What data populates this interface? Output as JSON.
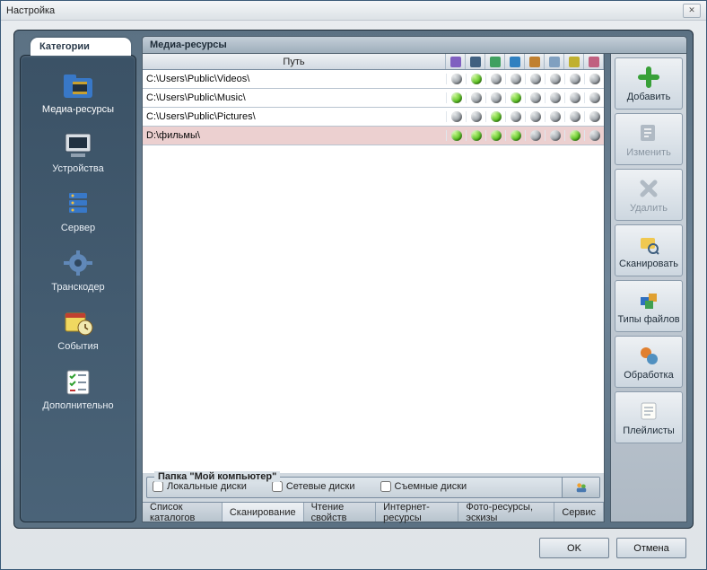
{
  "window": {
    "title": "Настройка"
  },
  "sidebar": {
    "tab": "Категории",
    "items": [
      {
        "label": "Медиа-ресурсы",
        "icon": "folder-media-icon",
        "selected": true
      },
      {
        "label": "Устройства",
        "icon": "devices-icon"
      },
      {
        "label": "Сервер",
        "icon": "server-icon"
      },
      {
        "label": "Транскодер",
        "icon": "gear-icon"
      },
      {
        "label": "События",
        "icon": "calendar-clock-icon"
      },
      {
        "label": "Дополнительно",
        "icon": "checklist-icon"
      }
    ]
  },
  "content": {
    "header": "Медиа-ресурсы",
    "table": {
      "path_header": "Путь",
      "col_icons": [
        "music-icon",
        "video-icon",
        "image-icon",
        "globe-icon",
        "speaker-icon",
        "cloud-icon",
        "cube-icon",
        "misc-icon"
      ],
      "rows": [
        {
          "path": "C:\\Users\\Public\\Videos\\",
          "cells": [
            "off",
            "on",
            "off",
            "off",
            "off",
            "off",
            "off",
            "off"
          ]
        },
        {
          "path": "C:\\Users\\Public\\Music\\",
          "cells": [
            "on",
            "off",
            "off",
            "on",
            "off",
            "off",
            "off",
            "off"
          ]
        },
        {
          "path": "C:\\Users\\Public\\Pictures\\",
          "cells": [
            "off",
            "off",
            "on",
            "off",
            "off",
            "off",
            "off",
            "off"
          ]
        },
        {
          "path": "D:\\фильмы\\",
          "cells": [
            "on",
            "on",
            "on",
            "on",
            "off",
            "off",
            "on",
            "off"
          ],
          "selected": true
        }
      ]
    },
    "groupbox": {
      "title": "Папка \"Мой компьютер\"",
      "checks": [
        {
          "label": "Локальные диски",
          "checked": false
        },
        {
          "label": "Сетевые диски",
          "checked": false
        },
        {
          "label": "Съемные диски",
          "checked": false
        }
      ]
    },
    "tabs": [
      {
        "label": "Список каталогов",
        "active": false
      },
      {
        "label": "Сканирование",
        "active": true
      },
      {
        "label": "Чтение свойств",
        "active": false
      },
      {
        "label": "Интернет-ресурсы",
        "active": false
      },
      {
        "label": "Фото-ресурсы, эскизы",
        "active": false
      },
      {
        "label": "Сервис",
        "active": false
      }
    ]
  },
  "buttons": [
    {
      "label": "Добавить",
      "icon": "plus-icon",
      "disabled": false
    },
    {
      "label": "Изменить",
      "icon": "edit-icon",
      "disabled": true
    },
    {
      "label": "Удалить",
      "icon": "delete-icon",
      "disabled": true
    },
    {
      "label": "Сканировать",
      "icon": "scan-icon",
      "disabled": false
    },
    {
      "label": "Типы файлов",
      "icon": "filetypes-icon",
      "disabled": false
    },
    {
      "label": "Обработка",
      "icon": "process-icon",
      "disabled": false
    },
    {
      "label": "Плейлисты",
      "icon": "playlist-icon",
      "disabled": false
    }
  ],
  "footer": {
    "ok": "OK",
    "cancel": "Отмена"
  }
}
